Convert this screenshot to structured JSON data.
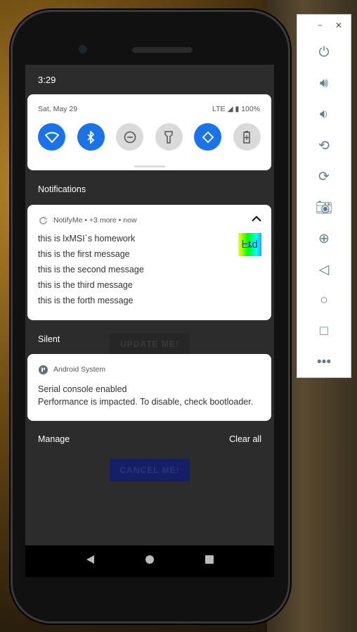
{
  "status_bar": {
    "time": "3:29"
  },
  "quick_settings": {
    "date": "Sat, May 29",
    "network": "LTE",
    "battery": "100%",
    "tiles": [
      {
        "icon": "wifi-icon",
        "active": true
      },
      {
        "icon": "bluetooth-icon",
        "active": true
      },
      {
        "icon": "do-not-disturb-icon",
        "active": false
      },
      {
        "icon": "flashlight-icon",
        "active": false
      },
      {
        "icon": "auto-rotate-icon",
        "active": true
      },
      {
        "icon": "battery-saver-icon",
        "active": false
      }
    ]
  },
  "notifications": {
    "section_label": "Notifications",
    "notify_me": {
      "app": "NotifyMe",
      "more": "+3 more",
      "time": "now",
      "lines": [
        "this is lxMSI`s homework",
        "this is the first message",
        "this is the second message",
        "this is the third message",
        "this is the forth message"
      ]
    }
  },
  "silent": {
    "section_label": "Silent",
    "android": {
      "app": "Android System",
      "title": "Serial console enabled",
      "body": "Performance is impacted. To disable, check bootloader."
    }
  },
  "footer": {
    "manage": "Manage",
    "clear_all": "Clear all"
  },
  "app_behind": {
    "update_button": "UPDATE ME!",
    "cancel_button": "CANCEL ME!"
  },
  "colors": {
    "accent": "#1a73e8"
  }
}
